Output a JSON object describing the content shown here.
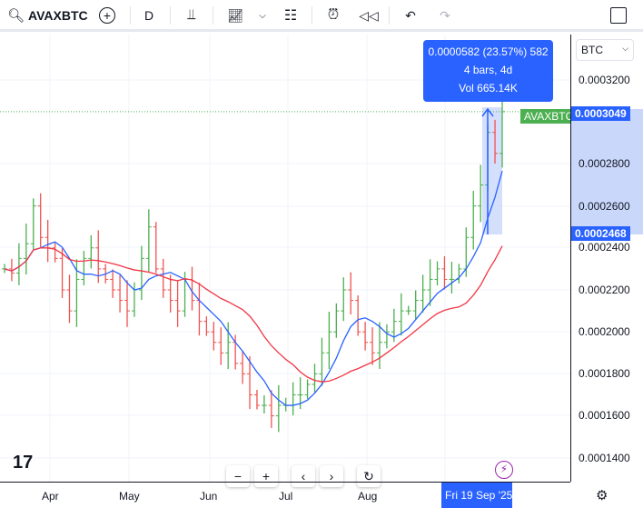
{
  "toolbar": {
    "symbol": "AVAXBTC",
    "interval": "D"
  },
  "tooltip": {
    "line1": "0.0000582 (23.57%) 582",
    "line2": "4 bars, 4d",
    "line3": "Vol 665.14K"
  },
  "price_axis": {
    "currency": "BTC",
    "labels": [
      "0.0003200",
      "0.0002800",
      "0.0002600",
      "0.0002400",
      "0.0002200",
      "0.0002000",
      "0.0001800",
      "0.0001600",
      "0.0001400"
    ],
    "last_price": "0.0003049",
    "range_low": "0.0002468",
    "symbol_tag": "AVAXBTC"
  },
  "time_axis": {
    "labels": [
      "Apr",
      "May",
      "Jun",
      "Jul",
      "Aug"
    ],
    "crosshair_date": "Fri 19 Sep '25"
  },
  "colors": {
    "up": "#4caf50",
    "down": "#ef5350",
    "ma_fast": "#2962ff",
    "ma_slow": "#f23645",
    "accent": "#2962ff"
  },
  "chart_data": {
    "type": "ohlc",
    "unit": "1e-7 BTC",
    "x_start": "2025-03-13",
    "x_end": "2025-09-19",
    "ylim": [
      1300,
      3350
    ],
    "close": [
      2300,
      2280,
      2350,
      2420,
      2600,
      2450,
      2400,
      2350,
      2200,
      2100,
      2250,
      2350,
      2400,
      2300,
      2250,
      2200,
      2150,
      2100,
      2200,
      2350,
      2500,
      2300,
      2200,
      2150,
      2100,
      2250,
      2150,
      2050,
      2000,
      1950,
      1900,
      1950,
      1850,
      1800,
      1700,
      1650,
      1650,
      1600,
      1650,
      1650,
      1700,
      1700,
      1750,
      1800,
      1900,
      2000,
      2100,
      2200,
      2150,
      2000,
      1950,
      1900,
      1950,
      2000,
      2050,
      2100,
      2100,
      2150,
      2200,
      2250,
      2300,
      2250,
      2250,
      2300,
      2450,
      2600,
      2700,
      2950,
      2850,
      3049
    ]
  }
}
